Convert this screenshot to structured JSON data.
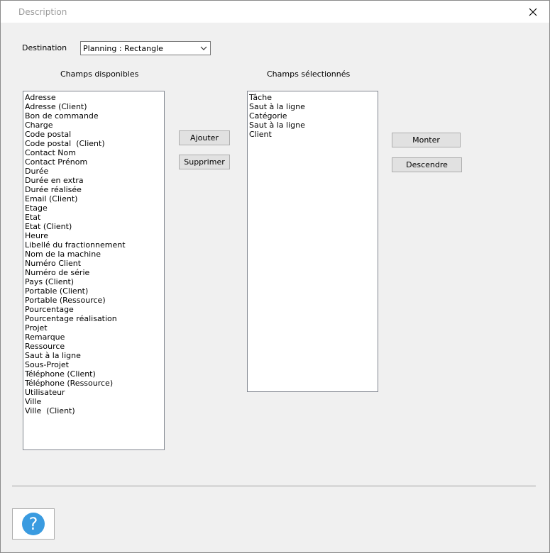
{
  "window": {
    "title": "Description"
  },
  "form": {
    "destination_label": "Destination",
    "destination_value": "Planning : Rectangle",
    "available_label": "Champs disponibles",
    "selected_label": "Champs sélectionnés"
  },
  "available_fields": [
    "Adresse",
    "Adresse (Client)",
    "Bon de commande",
    "Charge",
    "Code postal",
    "Code postal  (Client)",
    "Contact Nom",
    "Contact Prénom",
    "Durée",
    "Durée en extra",
    "Durée réalisée",
    "Email (Client)",
    "Etage",
    "Etat",
    "Etat (Client)",
    "Heure",
    "Libellé du fractionnement",
    "Nom de la machine",
    "Numéro Client",
    "Numéro de série",
    "Pays (Client)",
    "Portable (Client)",
    "Portable (Ressource)",
    "Pourcentage",
    "Pourcentage réalisation",
    "Projet",
    "Remarque",
    "Ressource",
    "Saut à la ligne",
    "Sous-Projet",
    "Téléphone (Client)",
    "Téléphone (Ressource)",
    "Utilisateur",
    "Ville",
    "Ville  (Client)"
  ],
  "selected_fields": [
    "Tâche",
    "Saut à la ligne",
    "Catégorie",
    "Saut à la ligne",
    "Client"
  ],
  "buttons": {
    "add": "Ajouter",
    "remove": "Supprimer",
    "up": "Monter",
    "down": "Descendre"
  },
  "colors": {
    "help_icon": "#3a9be0",
    "dialog_bg": "#f0f0f0"
  },
  "icons": {
    "close": "close-icon",
    "dropdown": "chevron-down-icon",
    "help": "help-icon"
  }
}
